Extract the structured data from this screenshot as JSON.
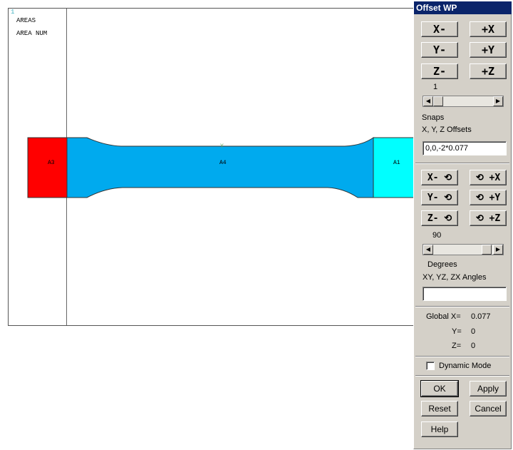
{
  "graphics": {
    "window_number": "1",
    "legend_line1": "AREAS",
    "legend_line2": "AREA NUM",
    "triad_label": "Y",
    "areas": [
      {
        "label": "A3",
        "color": "#ff0000"
      },
      {
        "label": "A4",
        "color": "#00aaee"
      },
      {
        "label": "A1",
        "color": "#00ffff"
      }
    ]
  },
  "panel": {
    "title": "Offset WP",
    "offset_buttons": {
      "x_minus": "X-",
      "x_plus": "+X",
      "y_minus": "Y-",
      "y_plus": "+Y",
      "z_minus": "Z-",
      "z_plus": "+Z"
    },
    "offset_slider_value": "1",
    "snaps_label": "Snaps",
    "offsets_label": "X, Y, Z Offsets",
    "offsets_value": "0,0,-2*0.077",
    "rotate_buttons": {
      "x_minus": "X- ⟲",
      "x_plus": "⟲ +X",
      "y_minus": "Y- ⟲",
      "y_plus": "⟲ +Y",
      "z_minus": "Z- ⟲",
      "z_plus": "⟲ +Z"
    },
    "rotate_slider_value": "90",
    "degrees_label": "Degrees",
    "angles_label": "XY, YZ, ZX Angles",
    "angles_value": "",
    "global_x_label": "Global X=",
    "global_x_value": "0.077",
    "y_label": "Y=",
    "y_value": "0",
    "z_label": "Z=",
    "z_value": "0",
    "dynamic_mode_label": "Dynamic Mode",
    "ok_label": "OK",
    "apply_label": "Apply",
    "reset_label": "Reset",
    "cancel_label": "Cancel",
    "help_label": "Help"
  }
}
